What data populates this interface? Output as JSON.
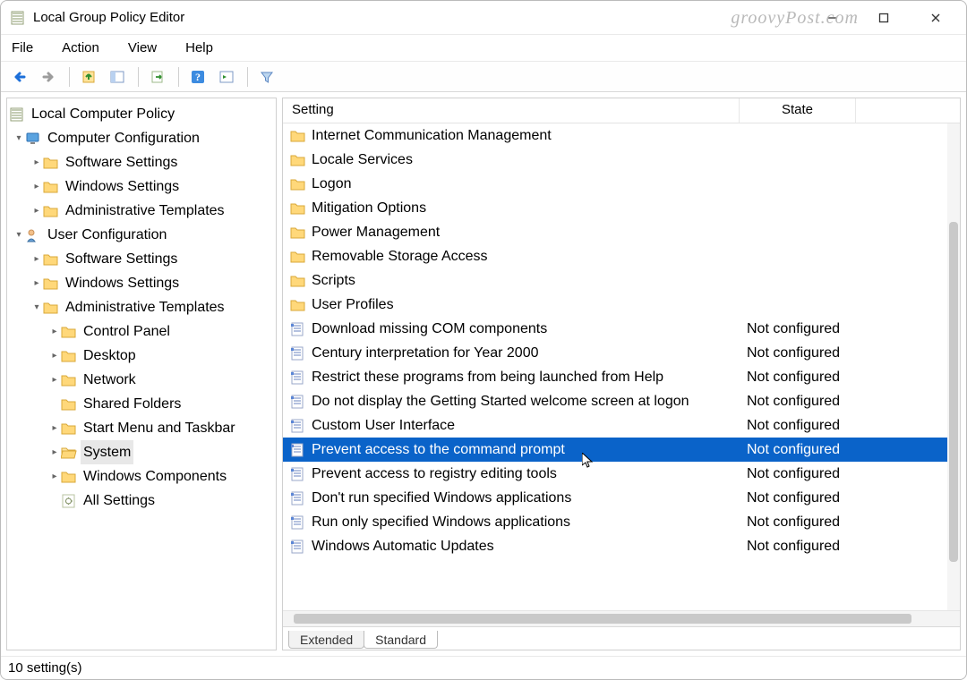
{
  "window": {
    "title": "Local Group Policy Editor",
    "watermark": "groovyPost.com"
  },
  "menu": {
    "file": "File",
    "action": "Action",
    "view": "View",
    "help": "Help"
  },
  "toolbar": {
    "back": "Back",
    "forward": "Forward",
    "up": "Up",
    "show_hide_tree": "Show/Hide Console Tree",
    "export": "Export List",
    "help": "Help",
    "action_pane": "Show/Hide Action Pane",
    "filter": "Filter"
  },
  "tree": {
    "root": "Local Computer Policy",
    "computer_config": "Computer Configuration",
    "cc_software": "Software Settings",
    "cc_windows": "Windows Settings",
    "cc_admin": "Administrative Templates",
    "user_config": "User Configuration",
    "uc_software": "Software Settings",
    "uc_windows": "Windows Settings",
    "uc_admin": "Administrative Templates",
    "uc_control_panel": "Control Panel",
    "uc_desktop": "Desktop",
    "uc_network": "Network",
    "uc_shared": "Shared Folders",
    "uc_startmenu": "Start Menu and Taskbar",
    "uc_system": "System",
    "uc_windows_components": "Windows Components",
    "uc_all_settings": "All Settings"
  },
  "list": {
    "header_setting": "Setting",
    "header_state": "State",
    "items": [
      {
        "type": "folder",
        "name": "Internet Communication Management",
        "state": ""
      },
      {
        "type": "folder",
        "name": "Locale Services",
        "state": ""
      },
      {
        "type": "folder",
        "name": "Logon",
        "state": ""
      },
      {
        "type": "folder",
        "name": "Mitigation Options",
        "state": ""
      },
      {
        "type": "folder",
        "name": "Power Management",
        "state": ""
      },
      {
        "type": "folder",
        "name": "Removable Storage Access",
        "state": ""
      },
      {
        "type": "folder",
        "name": "Scripts",
        "state": ""
      },
      {
        "type": "folder",
        "name": "User Profiles",
        "state": ""
      },
      {
        "type": "setting",
        "name": "Download missing COM components",
        "state": "Not configured"
      },
      {
        "type": "setting",
        "name": "Century interpretation for Year 2000",
        "state": "Not configured"
      },
      {
        "type": "setting",
        "name": "Restrict these programs from being launched from Help",
        "state": "Not configured"
      },
      {
        "type": "setting",
        "name": "Do not display the Getting Started welcome screen at logon",
        "state": "Not configured"
      },
      {
        "type": "setting",
        "name": "Custom User Interface",
        "state": "Not configured"
      },
      {
        "type": "setting",
        "name": "Prevent access to the command prompt",
        "state": "Not configured",
        "selected": true
      },
      {
        "type": "setting",
        "name": "Prevent access to registry editing tools",
        "state": "Not configured"
      },
      {
        "type": "setting",
        "name": "Don't run specified Windows applications",
        "state": "Not configured"
      },
      {
        "type": "setting",
        "name": "Run only specified Windows applications",
        "state": "Not configured"
      },
      {
        "type": "setting",
        "name": "Windows Automatic Updates",
        "state": "Not configured"
      }
    ]
  },
  "tabs": {
    "extended": "Extended",
    "standard": "Standard"
  },
  "status": {
    "text": "10 setting(s)"
  }
}
